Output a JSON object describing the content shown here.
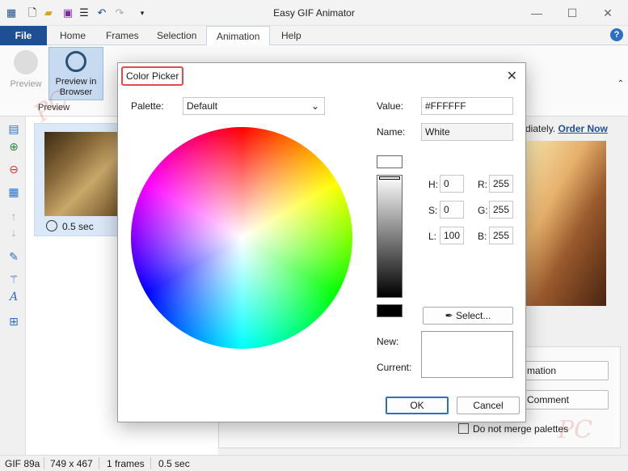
{
  "app": {
    "title": "Easy GIF Animator"
  },
  "window_controls": {
    "minimize": "—",
    "maximize": "☐",
    "close": "✕"
  },
  "tabs": {
    "file": "File",
    "home": "Home",
    "frames": "Frames",
    "selection": "Selection",
    "animation": "Animation",
    "help": "Help"
  },
  "ribbon": {
    "preview": "Preview",
    "preview_in_browser_1": "Preview in",
    "preview_in_browser_2": "Browser",
    "group_preview": "Preview"
  },
  "frames_panel": {
    "frame1_time": "0.5 sec"
  },
  "preview_area": {
    "promo_text": "diately.",
    "promo_link": "Order Now"
  },
  "props_panel": {
    "btn_animation": "mation",
    "btn_comment": "Comment",
    "do_not_merge": "Do not merge palettes"
  },
  "status": {
    "format": "GIF 89a",
    "size": "749 x 467",
    "frames": "1 frames",
    "duration": "0.5 sec"
  },
  "dialog": {
    "title": "Color Picker",
    "close": "✕",
    "palette_label": "Palette:",
    "palette_value": "Default",
    "value_label": "Value:",
    "value": "#FFFFFF",
    "name_label": "Name:",
    "name": "White",
    "h_label": "H:",
    "h": "0",
    "s_label": "S:",
    "s": "0",
    "l_label": "L:",
    "l": "100",
    "r_label": "R:",
    "r": "255",
    "g_label": "G:",
    "g": "255",
    "b_label": "B:",
    "b": "255",
    "select_btn": "Select...",
    "new_label": "New:",
    "current_label": "Current:",
    "ok": "OK",
    "cancel": "Cancel"
  },
  "colors": {
    "accent": "#1e4f95",
    "highlight": "#e34b4b"
  }
}
